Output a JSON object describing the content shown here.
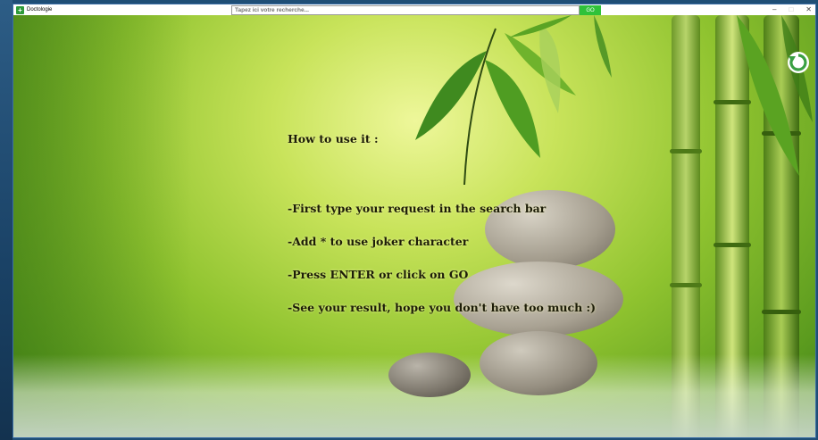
{
  "window": {
    "title": "Doctologie",
    "controls": {
      "minimize": "–",
      "maximize": "□",
      "close": "✕"
    }
  },
  "search": {
    "placeholder": "Tapez ici votre recherche...",
    "go_label": "GO"
  },
  "help": {
    "heading": "How to use it :",
    "lines": [
      "-First type your request in the search bar",
      "-Add * to use joker character",
      "-Press ENTER or click on GO",
      "-See your result, hope you don't have too much :)"
    ]
  },
  "icons": {
    "app": "doctologie-cross-icon",
    "refresh": "refresh-icon"
  },
  "colors": {
    "go_button": "#2fc23a",
    "refresh_icon": "#3aa043",
    "text": "#1c1c08"
  }
}
